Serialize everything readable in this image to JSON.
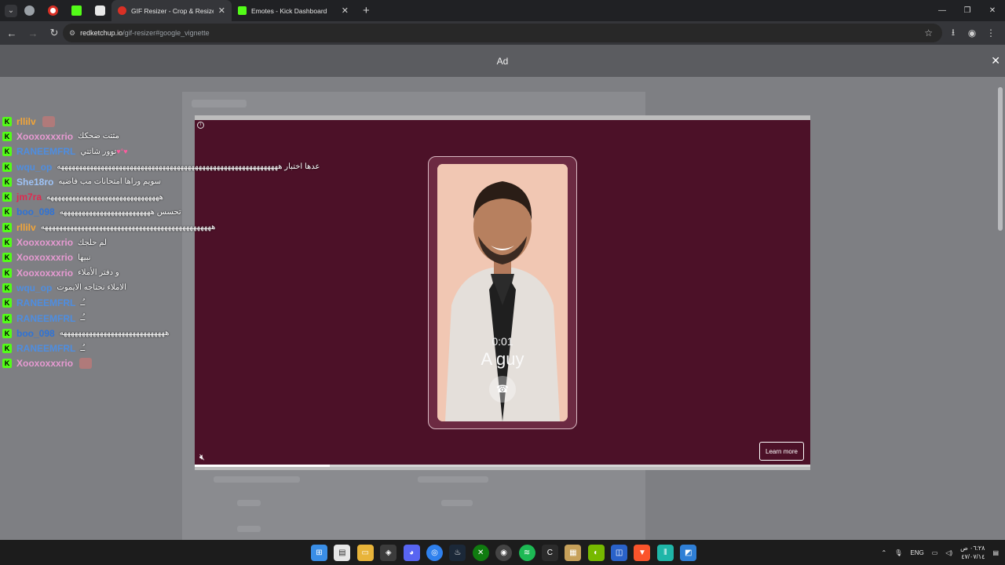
{
  "browser": {
    "tabs": [
      {
        "title": "GIF Resizer - Crop & Resize Ani",
        "active": true,
        "favicon_color": "#d93025"
      },
      {
        "title": "Emotes - Kick Dashboard",
        "active": false,
        "favicon_color": "#53fc18"
      }
    ],
    "url_host": "redketchup.io",
    "url_path": "/gif-resizer#google_vignette"
  },
  "ad": {
    "label": "Ad",
    "call_time": "0:01",
    "call_name": "A guy",
    "cta": "Learn more",
    "progress": 0.22
  },
  "chat": [
    {
      "user": "rllilv",
      "color": "#f3a537",
      "msg": "",
      "emote": true
    },
    {
      "user": "Xooxoxxxrio",
      "color": "#e79ad2",
      "msg": "مثتت ضحكك"
    },
    {
      "user": "RANEEMFRL",
      "color": "#4e8de0",
      "msg": "توور شاتتي",
      "hearts": "♥°♥"
    },
    {
      "user": "wqu_op",
      "color": "#4e8de0",
      "msg": "عدها اختبار هههههههههههههههههههههههههههههههههههههههههههههههههههههههههههههه"
    },
    {
      "user": "She18ro",
      "color": "#9ec3f7",
      "msg": "سويم وراها امتحانات مب فاضيه"
    },
    {
      "user": "jm7ra",
      "color": "#e0294f",
      "msg": "هههههههههههههههههههههههههههههههه"
    },
    {
      "user": "boo_098",
      "color": "#2f73d6",
      "msg": "تحسس هههههههههههههههههههههههههه"
    },
    {
      "user": "rllilv",
      "color": "#f3a537",
      "msg": "هههههههههههههههههههههههههههههههههههههههههههههههه"
    },
    {
      "user": "Xooxoxxxrio",
      "color": "#e79ad2",
      "msg": "لم حلجك"
    },
    {
      "user": "Xooxoxxxrio",
      "color": "#e79ad2",
      "msg": "نبيها"
    },
    {
      "user": "Xooxoxxxrio",
      "color": "#e79ad2",
      "msg": "و دفتر الأملاء"
    },
    {
      "user": "wqu_op",
      "color": "#4e8de0",
      "msg": "الاملاء نحتاجه الايموت"
    },
    {
      "user": "RANEEMFRL",
      "color": "#4e8de0",
      "msg": "ـُـ"
    },
    {
      "user": "RANEEMFRL",
      "color": "#4e8de0",
      "msg": "ـُـ"
    },
    {
      "user": "boo_098",
      "color": "#2f73d6",
      "msg": "هههههههههههههههههههههههههههههه"
    },
    {
      "user": "RANEEMFRL",
      "color": "#4e8de0",
      "msg": "ـُـ"
    },
    {
      "user": "Xooxoxxxrio",
      "color": "#e79ad2",
      "msg": "",
      "emote": true
    }
  ],
  "taskbar": {
    "lang": "ENG",
    "time": "٠٦:٢٨ ص",
    "date": "٤٧/٠٧/١٤"
  }
}
